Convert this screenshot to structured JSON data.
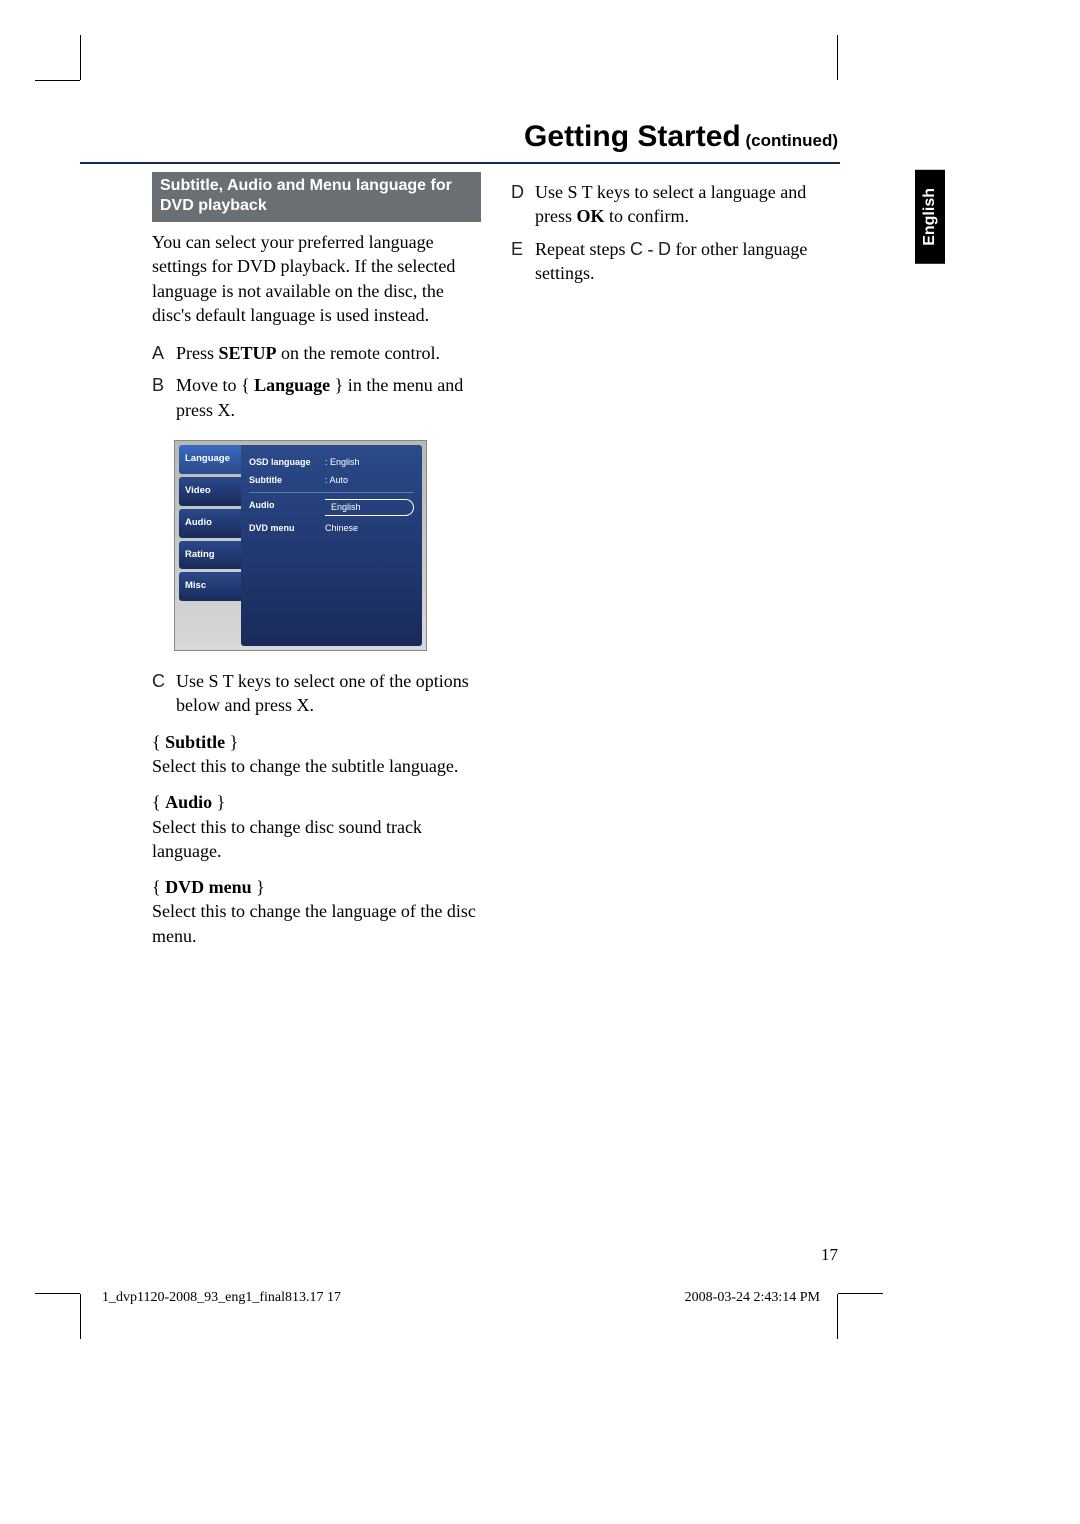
{
  "header": {
    "title": "Getting Started",
    "continued": " (continued)"
  },
  "lang_tab": "English",
  "page_number": "17",
  "footer": {
    "file": "1_dvp1120-2008_93_eng1_final813.17   17",
    "timestamp": "2008-03-24   2:43:14 PM"
  },
  "section_bar": "Subtitle,  Audio and Menu language for DVD playback",
  "intro": "You can select your preferred language settings for DVD playback. If the selected language is not available on the disc, the disc's default language is used instead.",
  "steps": {
    "A": {
      "pre": "Press ",
      "bold": "SETUP",
      "post": " on the remote control."
    },
    "B": {
      "pre": "Move to { ",
      "bold": "Language",
      "post": " } in the menu and press  X."
    },
    "C": {
      "text": "Use  S T  keys to select one of the options below and press  X."
    },
    "D": {
      "pre": "Use  S T  keys to select a language and press ",
      "bold": "OK",
      "post": " to confirm."
    },
    "E": {
      "pre": "Repeat steps ",
      "m1": "C",
      "mid": " - ",
      "m2": "D",
      "post": "  for other language settings."
    }
  },
  "options": {
    "subtitle": {
      "label": "Subtitle",
      "desc": "Select this to change the subtitle language."
    },
    "audio": {
      "label": "Audio",
      "desc": "Select this to change disc sound track language."
    },
    "dvdmenu": {
      "label": "DVD menu",
      "desc": "Select this to change the language of the disc menu."
    }
  },
  "menu": {
    "tabs": [
      "Language",
      "Video",
      "Audio",
      "Rating",
      "Misc"
    ],
    "rows": [
      {
        "k": "OSD language",
        "v": ": English"
      },
      {
        "k": "Subtitle",
        "v": ": Auto"
      },
      {
        "k": "Audio",
        "v": "English",
        "sel": true
      },
      {
        "k": "DVD menu",
        "v": "Chinese"
      }
    ]
  }
}
